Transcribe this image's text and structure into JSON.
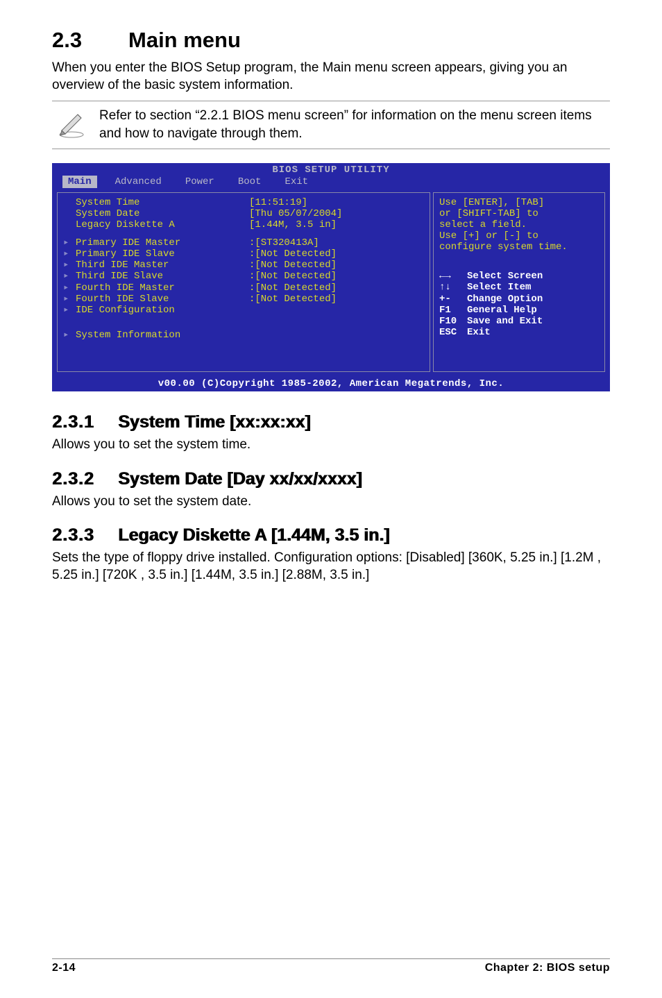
{
  "heading": {
    "num": "2.3",
    "title": "Main menu"
  },
  "intro": "When you enter the BIOS Setup program, the Main menu screen appears, giving you an overview of the basic system information.",
  "note": "Refer to section “2.2.1  BIOS menu screen” for information on the menu screen items and how to navigate through them.",
  "bios": {
    "title": "BIOS SETUP UTILITY",
    "tabs": [
      "Main",
      "Advanced",
      "Power",
      "Boot",
      "Exit"
    ],
    "active_tab": "Main",
    "left_top": [
      {
        "label": "System Time",
        "value": "[11:51:19]"
      },
      {
        "label": "System Date",
        "value": "[Thu 05/07/2004]"
      },
      {
        "label": "Legacy Diskette A",
        "value": "[1.44M, 3.5 in]"
      }
    ],
    "left_sub": [
      {
        "label": "Primary IDE Master",
        "value": ":[ST320413A]"
      },
      {
        "label": "Primary IDE Slave",
        "value": ":[Not Detected]"
      },
      {
        "label": "Third IDE Master",
        "value": ":[Not Detected]"
      },
      {
        "label": "Third IDE Slave",
        "value": ":[Not Detected]"
      },
      {
        "label": "Fourth IDE Master",
        "value": ":[Not Detected]"
      },
      {
        "label": "Fourth IDE Slave",
        "value": ":[Not Detected]"
      },
      {
        "label": "IDE Configuration",
        "value": ""
      }
    ],
    "left_sub2": [
      {
        "label": "System Information",
        "value": ""
      }
    ],
    "help": [
      "Use [ENTER], [TAB]",
      "or [SHIFT-TAB] to",
      "select a field.",
      "",
      "Use [+] or [-] to",
      "configure system time."
    ],
    "legend": [
      {
        "key": "←→",
        "act": "Select Screen"
      },
      {
        "key": "↑↓",
        "act": "Select Item"
      },
      {
        "key": "+-",
        "act": "Change Option"
      },
      {
        "key": "F1",
        "act": "General Help"
      },
      {
        "key": "F10",
        "act": "Save and Exit"
      },
      {
        "key": "ESC",
        "act": "Exit"
      }
    ],
    "footer": "v00.00 (C)Copyright 1985-2002, American Megatrends, Inc."
  },
  "s231": {
    "num": "2.3.1",
    "title": "System Time [xx:xx:xx]",
    "body": "Allows you to set the system time."
  },
  "s232": {
    "num": "2.3.2",
    "title": "System Date [Day xx/xx/xxxx]",
    "body": "Allows you to set the system date."
  },
  "s233": {
    "num": "2.3.3",
    "title": "Legacy Diskette A [1.44M, 3.5 in.]",
    "body": "Sets the type of floppy drive installed. Configuration options: [Disabled] [360K, 5.25 in.] [1.2M , 5.25 in.] [720K , 3.5 in.] [1.44M, 3.5 in.] [2.88M, 3.5 in.]"
  },
  "footer": {
    "left": "2-14",
    "right": "Chapter 2: BIOS setup"
  }
}
